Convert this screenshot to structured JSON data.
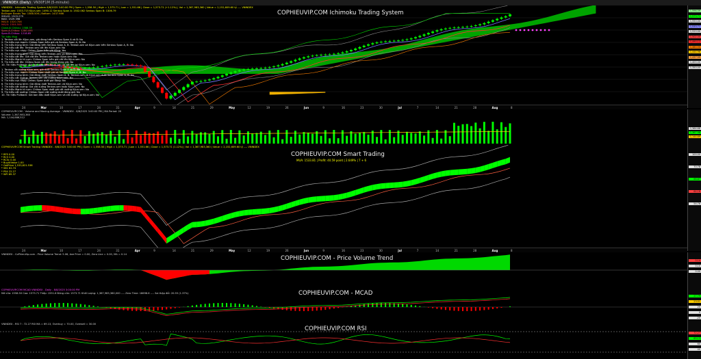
{
  "tabs": [
    {
      "label": "VNINDEX (Daily)"
    },
    {
      "label": "VN30F1M (5-minute)"
    }
  ],
  "panes": {
    "ichimoku": {
      "title": "COPHIEUVIP.COM Ichimoku Trading System",
      "header": "VNINDEX - Ichimoku Trading System 8/8/2025 3:00:00 PM | Open = 1,558.50 | High = 1,573.71 | Low = 1,551.66 | Close = 1,573.71 (+1.12%) | Vol = 1,367,983,360 | Value = 2,152,609.60 tỷ ---- VNINDEX",
      "info": [
        "Tenkan-sen: 1533.715 Kijun-sen: 1490.12 Senkou Span A: 1502.062 Senkou Span B: 1306.79",
        "Bollinger Bands Top: 1588.506 | Bottom: 1437.986",
        "SMA20: 1503.279",
        "MA5: 1529.396",
        "MA10: 1520.706",
        "MA20: 1504.508",
        "Close-Ai Chikou: 1588.59",
        "Span-A-Chikou: 1280.495",
        "Span-B-Chikou: 1218.85"
      ],
      "legend_title": "Tín hiệu Mua",
      "buy_signals": [
        "1. Tenkan cắt lên Kijun-sen, giá đang trên Senkou Span A và B: No",
        "2. Tín hiệu cực mạnh: Chikou Span trên giá và Senkou Span A, B: No",
        "3. Tín hiệu trung bình: Giá đóng trên Senkou Span A, B. Tenkan-sen và Kijun-sen trên Senkou Span A, B: No",
        "4. Tín hiệu cắt lên: Tenkan-sen cắt lên Kijun-sen: No",
        "5. Tín hiệu cực nhạy: Chikou Span trên giá đóng: Yes",
        "6. Tín hiệu trung bình: Giá đóng trên Tenkan-sen và Kijun-sen: Yes",
        "7. Tín hiệu cắt lên: Giá cắt lên Tenkan-sen hoặc Kijun-sen: No",
        "8. Tín hiệu Mạnh từ cụm: Chikou Span trên giá cắt lên Kijun-sen: No",
        "9. Tín hiệu cắt lên: Chikou Span cắt lên trong đúng giá: No",
        "10. Tín hiệu Pullback: Giá ban đầu trên Kijun-sen và cắt lên lại Kijun-sen: No"
      ],
      "sell_signals": [
        "1. Tenkan cắt xuống Kijun-sen, giá dưới Senkou Span A và B: No",
        "2. Tín hiệu cực mạnh: Chikou Span dưới giá và Senkou Span A, B: No",
        "3. Tín hiệu trung bình: Giá đóng dưới Senkou Span A, B. Tenkan-sen và Kijun-sen dưới Senkou Span A, B: No",
        "4. Tín hiệu cắt xuống: Tenkan-sen cắt xuống Kijun-sen: No",
        "5. Tín hiệu cực nhạy: Chikou Span dưới giá đóng: No",
        "6. Tín hiệu trung bình: Giá đóng dưới Tenkan-sen và Kijun-sen: No",
        "7. Tín hiệu cắt xuống: Giá cắt xuống Tenkan-sen hoặc Kijun-sen: No",
        "8. Tín hiệu Mạnh từ cụm: Chikou Span dưới giá cắt xuống Kijun-sen: No",
        "9. Tín hiệu cắt xuống: Chikou Span cắt xuống dưới đúng giá: No",
        "10. Tín hiệu Pullback: Giá ban đầu dưới Kijun-sen và cắt xuống lại Kijun-sen: No"
      ],
      "price_labels": [
        {
          "text": "1,596.59",
          "color": "#9cff9c"
        },
        {
          "text": "1,573.71",
          "color": "#00ff00"
        },
        {
          "text": "1,550.00",
          "color": "#e0e0e0"
        },
        {
          "text": "1,533.71",
          "color": "#8888ff"
        },
        {
          "text": "1,520.00",
          "color": "#e0e0e0"
        },
        {
          "text": "1,502.00",
          "color": "#ff4040"
        },
        {
          "text": "1,490.12",
          "color": "#ff3030"
        },
        {
          "text": "1,460.50",
          "color": "#ff8000"
        },
        {
          "text": "1,444.96",
          "color": "#ffcc00"
        },
        {
          "text": "1,437.99",
          "color": "#ffa040"
        },
        {
          "text": "1,400.00",
          "color": "#e0e0e0"
        },
        {
          "text": "1,350.00",
          "color": "#e0e0e0"
        }
      ]
    },
    "volume": {
      "header": "COPHIEUVIP.COM - Volume and Moving Average - VNINDEX - 8/8/2025 3:00:00 PM | MA Period: 20",
      "vol_text": "Volume: 1,367,983,360",
      "ma_text": "MA: 1,144,686,512",
      "labels": [
        {
          "text": "1,364.68",
          "color": "#e0e0e0"
        },
        {
          "text": "1,367.98",
          "color": "#00ff00"
        },
        {
          "text": "1,144.69",
          "color": "#ffcc00"
        }
      ]
    },
    "smart": {
      "title": "COPHIEUVIP.COM Smart Trading",
      "header": "COPHIEUVIP.COM Smart Trading     VNINDEX - 8/8/2025 3:00:00 PM | Open = 1,558.50 | High = 1,573.71 | Low = 1,551.66 | Close = 1,573.71 (1.12%) | Vol = 1,367,983,360 | Value = 2,152,609.60 tỷ ---- VNINDEX",
      "subtitle": "MUA: 1533.81 | Profit: 40.59 point | 2.649% | T + 6",
      "indicators": [
        "* RP5     0.00",
        "* RC5     0.00",
        "* RC5c    0.00",
        "* BuyAtValue   1.00",
        "* GetPrice   1,533,821.536",
        "* S61     62.74",
        "* PS4     22.27",
        "* WFI     69.37"
      ],
      "labels": [
        {
          "text": "100.00",
          "color": "#e0e0e0"
        },
        {
          "text": "70.78",
          "color": "#e0e0e0"
        },
        {
          "text": "68.87",
          "color": "#00ff00"
        },
        {
          "text": "64.18",
          "color": "#ff4040"
        },
        {
          "text": "54.76",
          "color": "#e0e0e0"
        }
      ]
    },
    "pvt": {
      "title": "COPHIEUVIP.COM - Price Volume Trend",
      "header": "VNINDEX - CoPhieuVip.com - Price Volume Trend: 5.06, Ave Price = 0.00, Zero Line = 0.00, MA = 0.14",
      "labels": [
        {
          "text": "0.14",
          "color": "#ff4040"
        },
        {
          "text": "0.10",
          "color": "#e0e0e0"
        },
        {
          "text": "0.00",
          "color": "#e0e0e0"
        }
      ]
    },
    "macd": {
      "title": "COPHIEUVIP.COM - MCAD",
      "header": "COPHIEUVIP.COM MCAD  VNINDEX - Daily - 8/8/2025 3:00:00 PM",
      "subheader": "Mở cửa: 1558.50  Cao: 1573.71  Thấp: 1551.6  Đóng cửa: 1573.71  Khối Lượng: 1,367,983,360,000 ---- Zero Time: 18698.6 ---- Sai thập đổi: 20.55 (1.37%)",
      "labels": [
        {
          "text": "27.79",
          "color": "#00ff00"
        },
        {
          "text": "23.01",
          "color": "#ffcc00"
        },
        {
          "text": "20",
          "color": "#e0e0e0"
        },
        {
          "text": "0",
          "color": "#e0e0e0"
        },
        {
          "text": "-20",
          "color": "#e0e0e0"
        }
      ]
    },
    "rsi": {
      "title": "COPHIEUVIP.COM RSI",
      "header": "VNINDEX - RSI 7 : 72.27   RSI MA = 69.13,   Overbuy = 70.00,   Oversell = 30.00",
      "labels": [
        {
          "text": "72.27",
          "color": "#ff4040"
        },
        {
          "text": "69.13",
          "color": "#00ff00"
        },
        {
          "text": "60",
          "color": "#e0e0e0"
        },
        {
          "text": "40",
          "color": "#e0e0e0"
        }
      ]
    }
  },
  "date_axis": [
    {
      "text": "24"
    },
    {
      "text": "Mar",
      "m": true
    },
    {
      "text": "10"
    },
    {
      "text": "17"
    },
    {
      "text": "24"
    },
    {
      "text": "31"
    },
    {
      "text": "Apr",
      "m": true
    },
    {
      "text": "9"
    },
    {
      "text": "14"
    },
    {
      "text": "21"
    },
    {
      "text": "29"
    },
    {
      "text": "May",
      "m": true
    },
    {
      "text": "12"
    },
    {
      "text": "19"
    },
    {
      "text": "26"
    },
    {
      "text": "Jun",
      "m": true
    },
    {
      "text": "9"
    },
    {
      "text": "16"
    },
    {
      "text": "23"
    },
    {
      "text": "30"
    },
    {
      "text": "Jul",
      "m": true
    },
    {
      "text": "7"
    },
    {
      "text": "14"
    },
    {
      "text": "21"
    },
    {
      "text": "28"
    },
    {
      "text": "Aug",
      "m": true
    },
    {
      "text": "8"
    }
  ],
  "colors": {
    "up": "#00ff00",
    "down": "#ff0000",
    "cloud": "#00c000",
    "cloud_bear": "#f0b000",
    "tenkan": "#7777ff",
    "kijun": "#ff3030",
    "title": "#f2f2f2"
  }
}
